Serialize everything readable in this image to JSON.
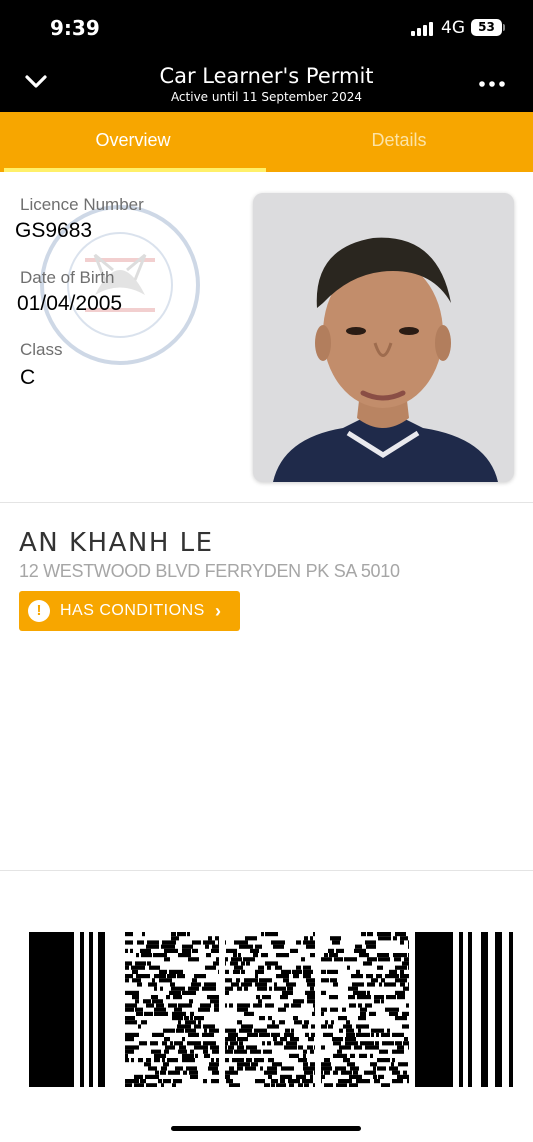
{
  "status_bar": {
    "time": "9:39",
    "network": "4G",
    "battery": "53"
  },
  "header": {
    "title": "Car Learner's Permit",
    "subtitle": "Active until 11 September 2024",
    "back_icon": "chevron-down-icon",
    "more_icon": "more-horizontal-icon"
  },
  "tabs": [
    {
      "label": "Overview",
      "active": true
    },
    {
      "label": "Details",
      "active": false
    }
  ],
  "licence": {
    "number_label": "Licence Number",
    "number": "GS9683",
    "dob_label": "Date of Birth",
    "dob": "01/04/2005",
    "class_label": "Class",
    "class": "C"
  },
  "holder": {
    "name": "AN KHANH LE",
    "address": "12 WESTWOOD BLVD FERRYDEN PK SA 5010"
  },
  "conditions": {
    "label": "HAS CONDITIONS",
    "icon": "alert-icon"
  },
  "colors": {
    "accent": "#f7a600",
    "header_bg": "#000000",
    "tab_indicator": "#fff06a"
  }
}
